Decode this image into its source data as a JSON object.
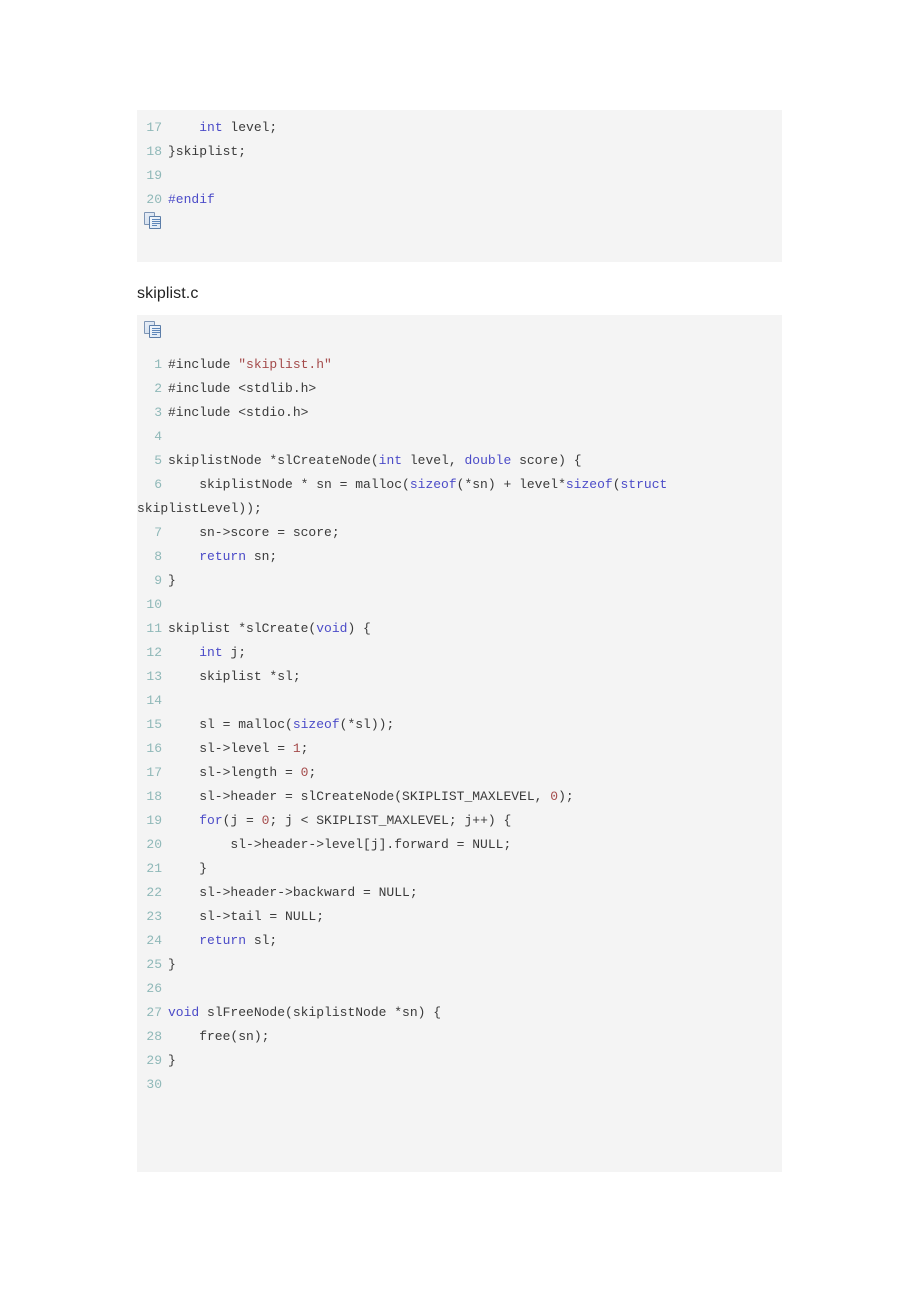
{
  "document": {
    "background_color": "#ffffff",
    "code_block_background": "#f4f4f4",
    "line_number_color": "#8fb8b8",
    "keyword_color": "#4b4bc8",
    "string_color": "#a44b4b",
    "number_color": "#a44b4b",
    "plain_code_color": "#3a3a3a"
  },
  "icons": {
    "copy_icon_name": "copy-icon"
  },
  "blocks": [
    {
      "id": "skiplist-h-tail",
      "language": "c",
      "lines": [
        {
          "number": "17",
          "tokens": [
            {
              "t": "    ",
              "c": "pl"
            },
            {
              "t": "int",
              "c": "k"
            },
            {
              "t": " level;",
              "c": "pl"
            }
          ]
        },
        {
          "number": "18",
          "tokens": [
            {
              "t": "}skiplist;",
              "c": "pl"
            }
          ]
        },
        {
          "number": "19",
          "tokens": [
            {
              "t": "",
              "c": "pl"
            }
          ]
        },
        {
          "number": "20",
          "tokens": [
            {
              "t": "#endif",
              "c": "pp"
            }
          ]
        }
      ]
    },
    {
      "id": "skiplist-c",
      "language": "c",
      "lines": [
        {
          "number": "1",
          "tokens": [
            {
              "t": "#include ",
              "c": "pl"
            },
            {
              "t": "\"skiplist.h\"",
              "c": "s"
            }
          ]
        },
        {
          "number": "2",
          "tokens": [
            {
              "t": "#include <stdlib.h>",
              "c": "pl"
            }
          ]
        },
        {
          "number": "3",
          "tokens": [
            {
              "t": "#include <stdio.h>",
              "c": "pl"
            }
          ]
        },
        {
          "number": "4",
          "tokens": [
            {
              "t": "",
              "c": "pl"
            }
          ]
        },
        {
          "number": "5",
          "tokens": [
            {
              "t": "skiplistNode *slCreateNode(",
              "c": "pl"
            },
            {
              "t": "int",
              "c": "k"
            },
            {
              "t": " level, ",
              "c": "pl"
            },
            {
              "t": "double",
              "c": "k"
            },
            {
              "t": " score) {",
              "c": "pl"
            }
          ]
        },
        {
          "number": "6",
          "tokens": [
            {
              "t": "    skiplistNode * sn = malloc(",
              "c": "pl"
            },
            {
              "t": "sizeof",
              "c": "k"
            },
            {
              "t": "(*sn) + level*",
              "c": "pl"
            },
            {
              "t": "sizeof",
              "c": "k"
            },
            {
              "t": "(",
              "c": "pl"
            },
            {
              "t": "struct",
              "c": "k"
            },
            {
              "t": " skiplistLevel));",
              "c": "pl"
            }
          ]
        },
        {
          "number": "7",
          "tokens": [
            {
              "t": "    sn->score = score;",
              "c": "pl"
            }
          ]
        },
        {
          "number": "8",
          "tokens": [
            {
              "t": "    ",
              "c": "pl"
            },
            {
              "t": "return",
              "c": "k"
            },
            {
              "t": " sn;",
              "c": "pl"
            }
          ]
        },
        {
          "number": "9",
          "tokens": [
            {
              "t": "}",
              "c": "pl"
            }
          ]
        },
        {
          "number": "10",
          "tokens": [
            {
              "t": "",
              "c": "pl"
            }
          ]
        },
        {
          "number": "11",
          "tokens": [
            {
              "t": "skiplist *slCreate(",
              "c": "pl"
            },
            {
              "t": "void",
              "c": "k"
            },
            {
              "t": ") {",
              "c": "pl"
            }
          ]
        },
        {
          "number": "12",
          "tokens": [
            {
              "t": "    ",
              "c": "pl"
            },
            {
              "t": "int",
              "c": "k"
            },
            {
              "t": " j;",
              "c": "pl"
            }
          ]
        },
        {
          "number": "13",
          "tokens": [
            {
              "t": "    skiplist *sl;",
              "c": "pl"
            }
          ]
        },
        {
          "number": "14",
          "tokens": [
            {
              "t": "",
              "c": "pl"
            }
          ]
        },
        {
          "number": "15",
          "tokens": [
            {
              "t": "    sl = malloc(",
              "c": "pl"
            },
            {
              "t": "sizeof",
              "c": "k"
            },
            {
              "t": "(*sl));",
              "c": "pl"
            }
          ]
        },
        {
          "number": "16",
          "tokens": [
            {
              "t": "    sl->level = ",
              "c": "pl"
            },
            {
              "t": "1",
              "c": "n"
            },
            {
              "t": ";",
              "c": "pl"
            }
          ]
        },
        {
          "number": "17",
          "tokens": [
            {
              "t": "    sl->length = ",
              "c": "pl"
            },
            {
              "t": "0",
              "c": "n"
            },
            {
              "t": ";",
              "c": "pl"
            }
          ]
        },
        {
          "number": "18",
          "tokens": [
            {
              "t": "    sl->header = slCreateNode(SKIPLIST_MAXLEVEL, ",
              "c": "pl"
            },
            {
              "t": "0",
              "c": "n"
            },
            {
              "t": ");",
              "c": "pl"
            }
          ]
        },
        {
          "number": "19",
          "tokens": [
            {
              "t": "    ",
              "c": "pl"
            },
            {
              "t": "for",
              "c": "k"
            },
            {
              "t": "(j = ",
              "c": "pl"
            },
            {
              "t": "0",
              "c": "n"
            },
            {
              "t": "; j < SKIPLIST_MAXLEVEL; j++) {",
              "c": "pl"
            }
          ]
        },
        {
          "number": "20",
          "tokens": [
            {
              "t": "        sl->header->level[j].forward = NULL;",
              "c": "pl"
            }
          ]
        },
        {
          "number": "21",
          "tokens": [
            {
              "t": "    }",
              "c": "pl"
            }
          ]
        },
        {
          "number": "22",
          "tokens": [
            {
              "t": "    sl->header->backward = NULL;",
              "c": "pl"
            }
          ]
        },
        {
          "number": "23",
          "tokens": [
            {
              "t": "    sl->tail = NULL;",
              "c": "pl"
            }
          ]
        },
        {
          "number": "24",
          "tokens": [
            {
              "t": "    ",
              "c": "pl"
            },
            {
              "t": "return",
              "c": "k"
            },
            {
              "t": " sl;",
              "c": "pl"
            }
          ]
        },
        {
          "number": "25",
          "tokens": [
            {
              "t": "}",
              "c": "pl"
            }
          ]
        },
        {
          "number": "26",
          "tokens": [
            {
              "t": "",
              "c": "pl"
            }
          ]
        },
        {
          "number": "27",
          "tokens": [
            {
              "t": "void",
              "c": "k"
            },
            {
              "t": " slFreeNode(skiplistNode *sn) {",
              "c": "pl"
            }
          ]
        },
        {
          "number": "28",
          "tokens": [
            {
              "t": "    free(sn);",
              "c": "pl"
            }
          ]
        },
        {
          "number": "29",
          "tokens": [
            {
              "t": "}",
              "c": "pl"
            }
          ]
        },
        {
          "number": "30",
          "tokens": [
            {
              "t": "",
              "c": "pl"
            }
          ]
        }
      ]
    }
  ],
  "headings": {
    "skiplist_c": "skiplist.c"
  }
}
